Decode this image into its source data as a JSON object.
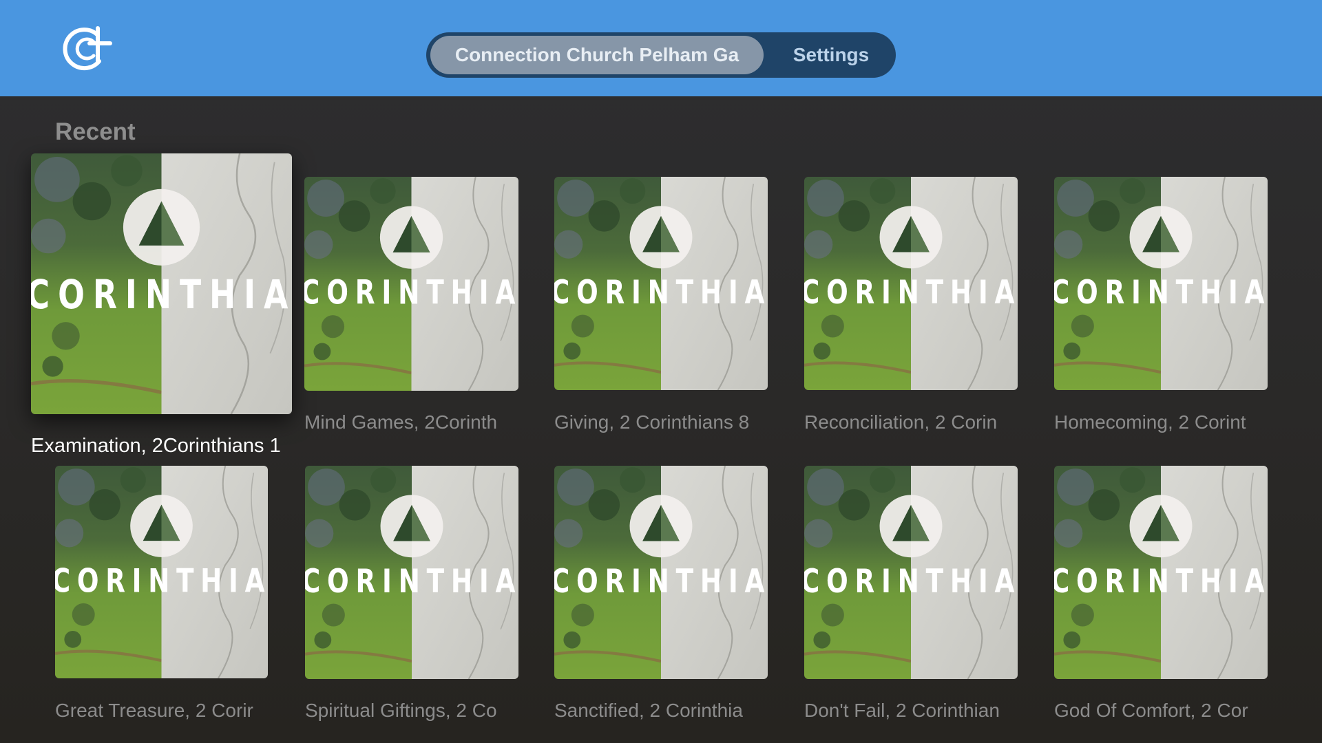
{
  "header": {
    "logo_icon": "connection-church-logo-icon",
    "tabs": [
      {
        "label": "Connection Church Pelham Ga",
        "selected": true
      },
      {
        "label": "Settings",
        "selected": false
      }
    ],
    "accent_color": "#4a96e0"
  },
  "section": {
    "title": "Recent"
  },
  "artwork": {
    "text": "CORINTHIA",
    "icon": "triangle-in-circle-icon"
  },
  "sermons": [
    {
      "title": "Examination, 2Corinthians 1",
      "focused": true
    },
    {
      "title": "Mind Games, 2Corinth"
    },
    {
      "title": "Giving, 2 Corinthians 8"
    },
    {
      "title": "Reconciliation, 2 Corin"
    },
    {
      "title": "Homecoming, 2 Corint"
    },
    {
      "title": "Great Treasure, 2 Corir"
    },
    {
      "title": "Spiritual Giftings, 2 Co"
    },
    {
      "title": "Sanctified, 2 Corinthia"
    },
    {
      "title": "Don't Fail, 2 Corinthian"
    },
    {
      "title": "God Of Comfort, 2 Cor"
    }
  ]
}
